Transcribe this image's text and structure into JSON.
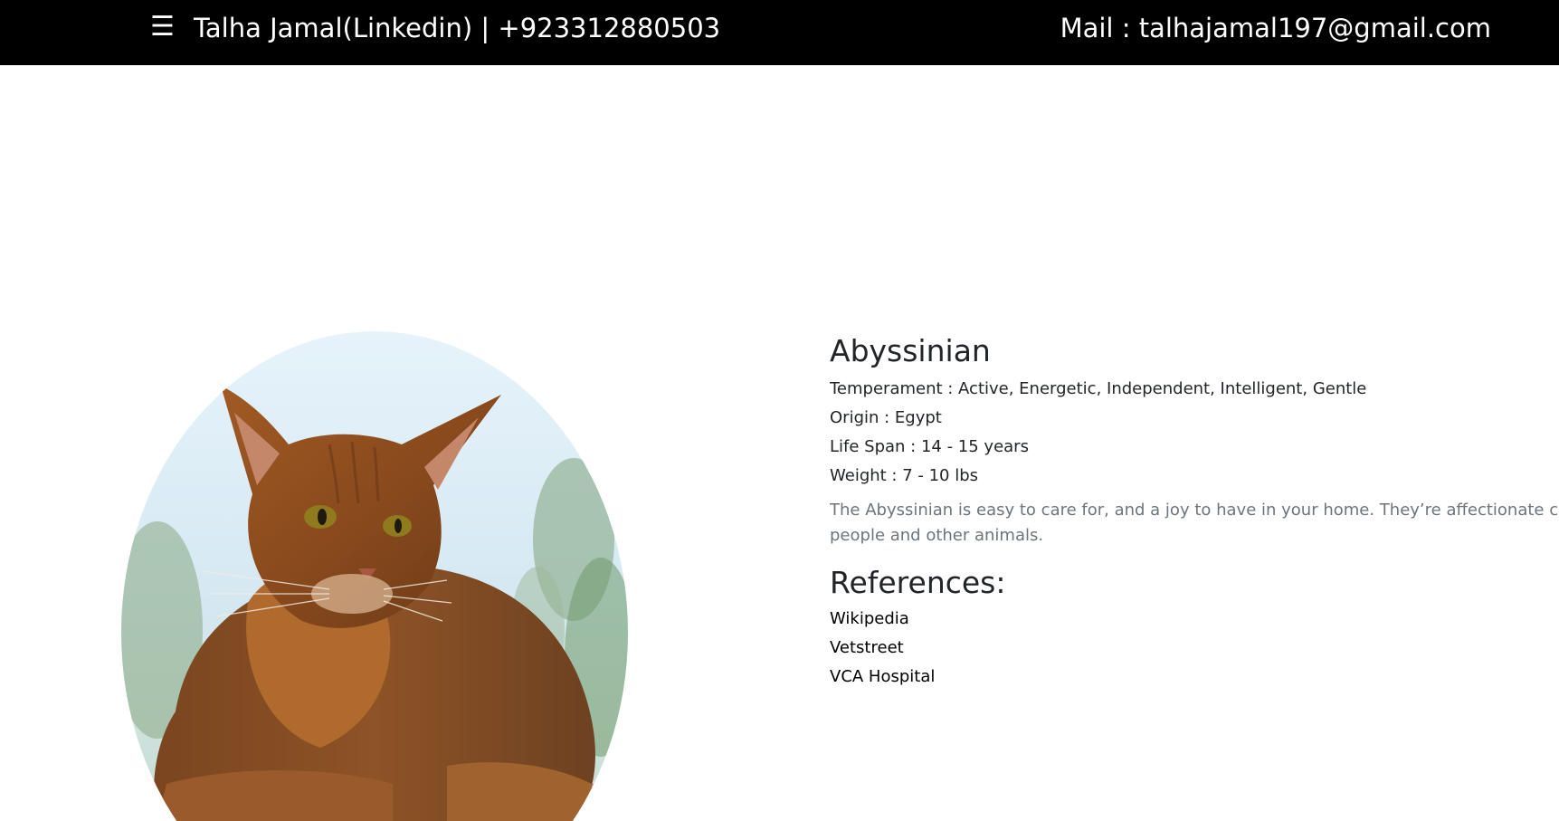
{
  "header": {
    "menu_icon": "hamburger-menu-icon",
    "brand_text": "Talha Jamal(Linkedin) | +923312880503",
    "mail_text": "Mail : talhajamal197@gmail.com"
  },
  "breed": {
    "name": "Abyssinian",
    "temperament": "Temperament : Active, Energetic, Independent, Intelligent, Gentle",
    "origin": "Origin : Egypt",
    "life_span": "Life Span : 14 - 15 years",
    "weight": "Weight : 7 - 10 lbs",
    "description_line1": "The Abyssinian is easy to care for, and a joy to have in your home. They’re affectionate cats and lo",
    "description_line2": "people and other animals.",
    "image_alt": "Abyssinian cat photo"
  },
  "references": {
    "heading": "References:",
    "links": [
      "Wikipedia",
      "Vetstreet",
      "VCA Hospital"
    ]
  },
  "colors": {
    "topbar_bg": "#000000",
    "topbar_text": "#ffffff",
    "description_text": "#6c757d"
  }
}
